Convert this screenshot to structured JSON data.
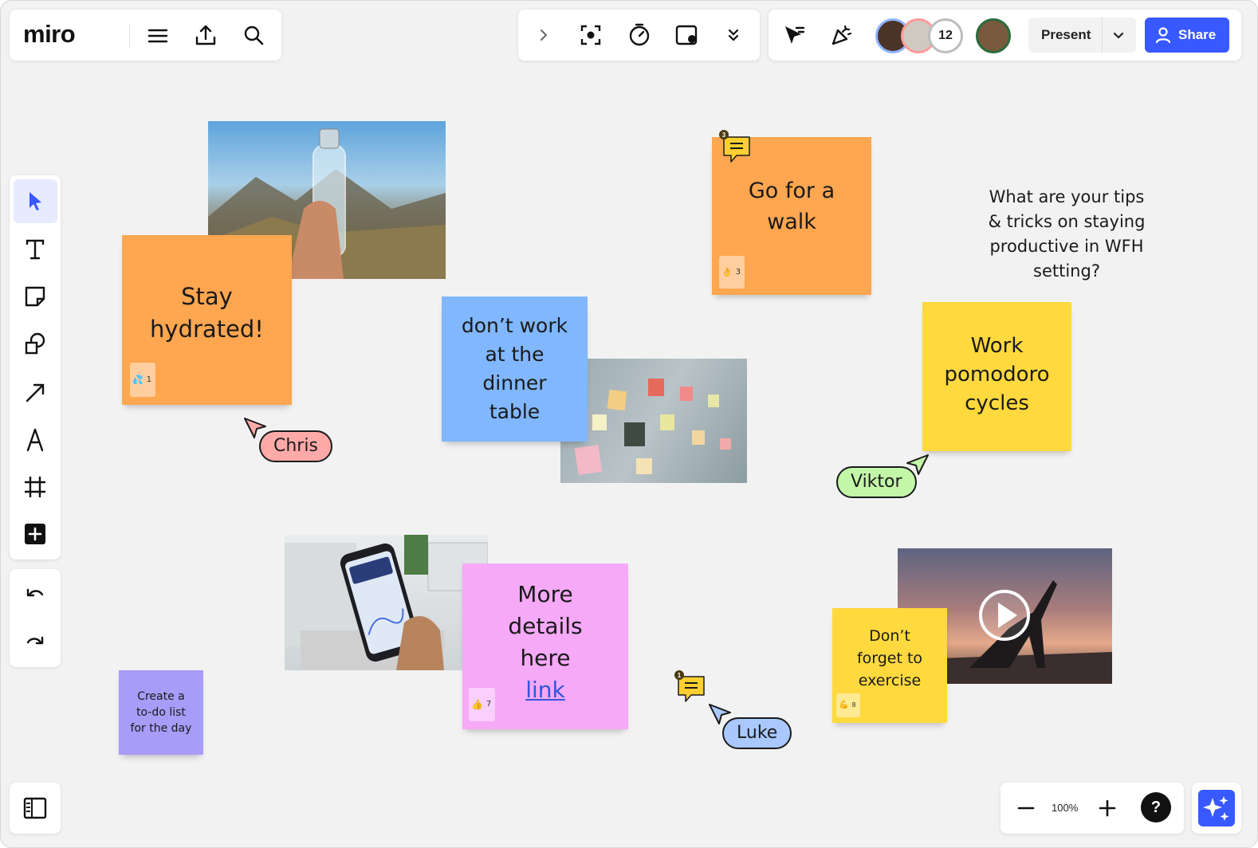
{
  "app": {
    "logo_text": "miro"
  },
  "header": {
    "present_label": "Present",
    "share_label": "Share",
    "participants_count": "12"
  },
  "canvas": {
    "question": "What are your tips\n& tricks on staying\nproductive in WFH\nsetting?",
    "stickies": [
      {
        "text": "Stay\nhydrated!",
        "color": "#ffa650",
        "reaction_count": "1"
      },
      {
        "text": "Go for a\nwalk",
        "color": "#ffa650",
        "reaction_count": "3"
      },
      {
        "text": "don’t work\nat the\ndinner\ntable",
        "color": "#80b7ff"
      },
      {
        "text": "Work\npomodoro\ncycles",
        "color": "#ffd93d"
      },
      {
        "text": "More\ndetails\nhere",
        "link_text": "link",
        "color": "#f5a9f7",
        "reaction_count": "7"
      },
      {
        "text": "Don’t\nforget to\nexercise",
        "color": "#ffd93d",
        "reaction_count": "8"
      },
      {
        "text": "Create a\nto-do list\nfor the day",
        "color": "#a79cf7"
      }
    ],
    "comments": [
      {
        "count": "3"
      },
      {
        "count": "1"
      }
    ],
    "cursors": [
      {
        "name": "Chris",
        "color": "#ffaaa8"
      },
      {
        "name": "Viktor",
        "color": "#c3f7a8"
      },
      {
        "name": "Luke",
        "color": "#a8c8ff"
      }
    ]
  },
  "zoom": {
    "level": "100%"
  },
  "colors": {
    "accent": "#3859ff",
    "comment_yellow": "#ffd02f"
  }
}
